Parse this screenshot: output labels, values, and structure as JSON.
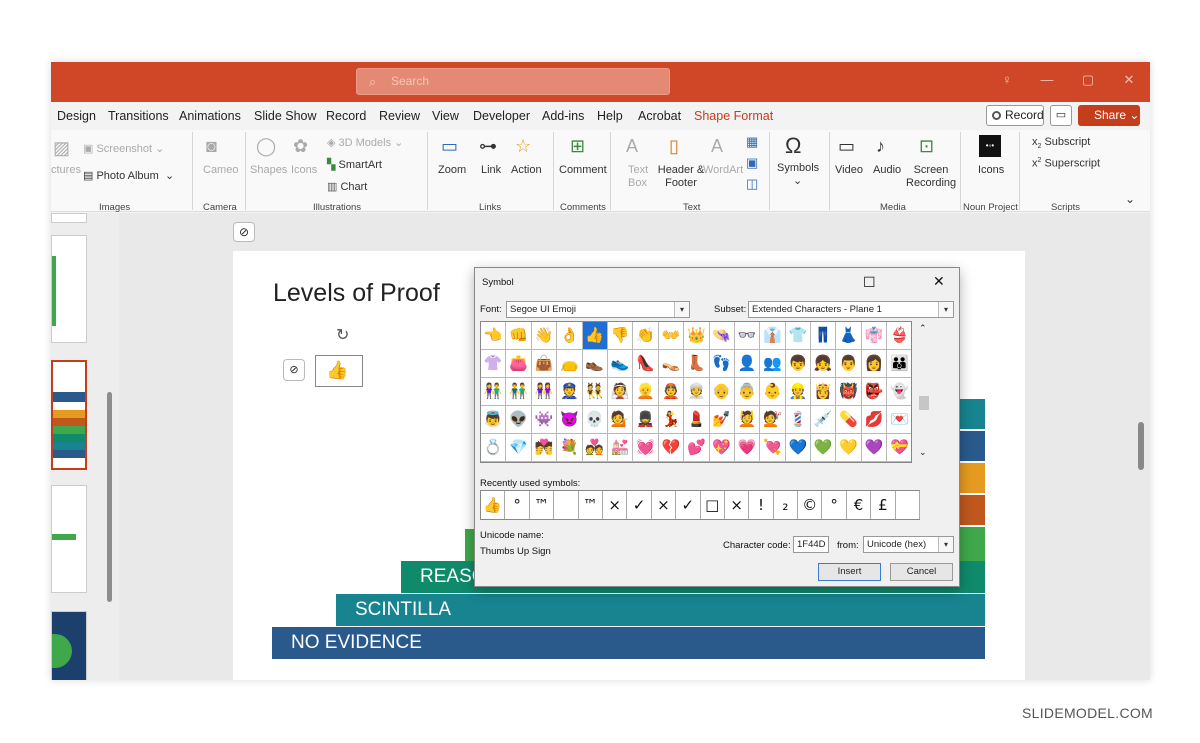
{
  "titlebar": {
    "search_placeholder": "Search"
  },
  "menu": [
    "Design",
    "Transitions",
    "Animations",
    "Slide Show",
    "Record",
    "Review",
    "View",
    "Developer",
    "Add-ins",
    "Help",
    "Acrobat",
    "Shape Format"
  ],
  "top_buttons": {
    "record": "Record",
    "share": "Share"
  },
  "ribbon": {
    "pictures": "ctures",
    "screenshot": "Screenshot",
    "photo_album": "Photo Album",
    "camera": "Cameo",
    "shapes": "Shapes",
    "icons": "Icons",
    "models_3d": "3D Models",
    "smartart": "SmartArt",
    "chart": "Chart",
    "zoom": "Zoom",
    "link": "Link",
    "action": "Action",
    "comment": "Comment",
    "text_box": "Text Box",
    "header_footer": "Header & Footer",
    "wordart": "WordArt",
    "symbols": "Symbols",
    "video": "Video",
    "audio": "Audio",
    "screen_recording": "Screen Recording",
    "icons2": "Icons",
    "subscript": "Subscript",
    "superscript": "Superscript",
    "groups": [
      "Images",
      "Camera",
      "Illustrations",
      "Links",
      "Comments",
      "Text",
      "Media",
      "Noun Project",
      "Scripts"
    ]
  },
  "slide": {
    "title": "Levels of Proof",
    "bars": [
      {
        "label": "REASO",
        "color": "#0f8a6b"
      },
      {
        "label": "SCINTILLA",
        "color": "#17848f"
      },
      {
        "label": "NO EVIDENCE",
        "color": "#2a5a8c"
      }
    ]
  },
  "dialog": {
    "title": "Symbol",
    "font_label": "Font:",
    "font_value": "Segoe UI Emoji",
    "subset_label": "Subset:",
    "subset_value": "Extended Characters - Plane 1",
    "grid_symbols": [
      "👈",
      "👊",
      "👋",
      "👌",
      "👍",
      "👎",
      "👏",
      "👐",
      "👑",
      "👒",
      "👓",
      "👔",
      "👕",
      "👖",
      "👗",
      "👘",
      "👙",
      "👚",
      "👛",
      "👜",
      "👝",
      "👞",
      "👟",
      "👠",
      "👡",
      "👢",
      "👣",
      "👤",
      "👥",
      "👦",
      "👧",
      "👨",
      "👩",
      "👪",
      "👫",
      "👬",
      "👭",
      "👮",
      "👯",
      "👰",
      "👱",
      "👲",
      "👳",
      "👴",
      "👵",
      "👶",
      "👷",
      "👸",
      "👹",
      "👺",
      "👻",
      "👼",
      "👽",
      "👾",
      "👿",
      "💀",
      "💁",
      "💂",
      "💃",
      "💄",
      "💅",
      "💆",
      "💇",
      "💈",
      "💉",
      "💊",
      "💋",
      "💌",
      "💍",
      "💎",
      "💏",
      "💐",
      "💑",
      "💒",
      "💓",
      "💔",
      "💕",
      "💖",
      "💗",
      "💘",
      "💙",
      "💚",
      "💛",
      "💜",
      "💝"
    ],
    "selected_index": 4,
    "recent_label": "Recently used symbols:",
    "recent_symbols": [
      "👍",
      "°",
      "™",
      " ",
      "™",
      "×",
      "✓",
      "×",
      "✓",
      "□",
      "×",
      "!",
      "₂",
      "©",
      "°",
      "€",
      "£",
      " "
    ],
    "unicode_name_label": "Unicode name:",
    "unicode_name": "Thumbs Up Sign",
    "char_code_label": "Character code:",
    "char_code": "1F44D",
    "from_label": "from:",
    "from_value": "Unicode (hex)",
    "insert": "Insert",
    "cancel": "Cancel"
  },
  "watermark": "SLIDEMODEL.COM"
}
